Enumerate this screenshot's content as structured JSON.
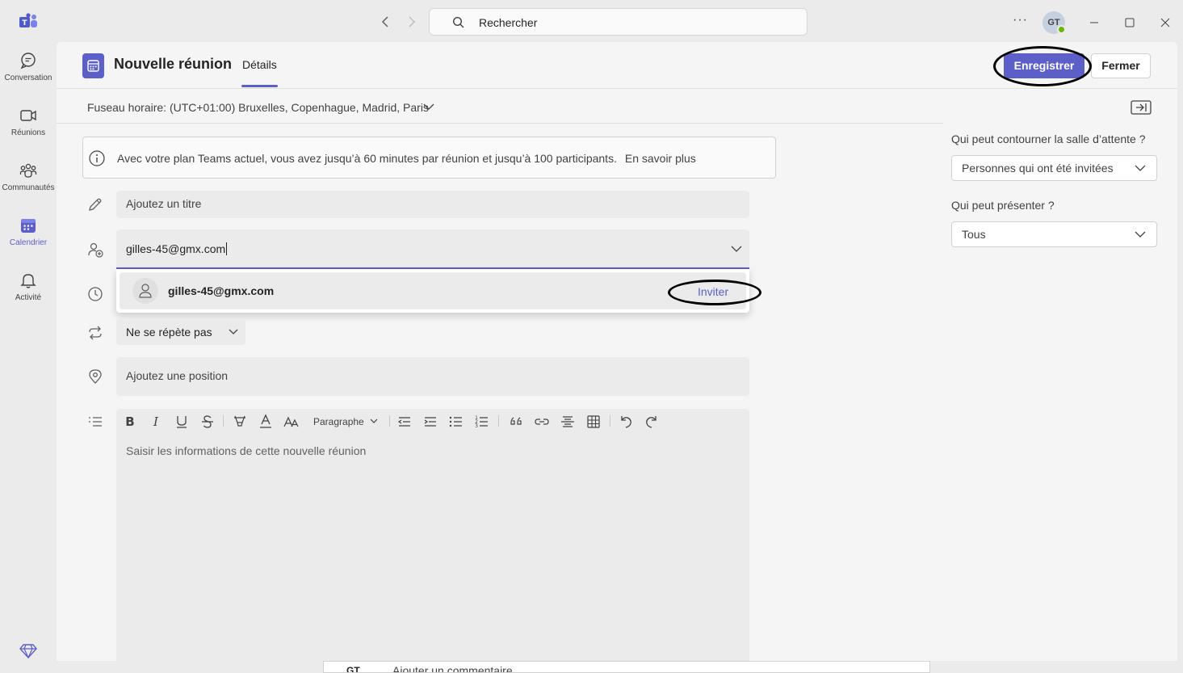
{
  "titlebar": {
    "search_placeholder": "Rechercher",
    "more_label": "···",
    "avatar_initials": "GT"
  },
  "rail": {
    "items": [
      {
        "label": "Conversation",
        "icon": "chat-icon"
      },
      {
        "label": "Réunions",
        "icon": "video-icon"
      },
      {
        "label": "Communautés",
        "icon": "community-icon"
      },
      {
        "label": "Calendrier",
        "icon": "calendar-icon",
        "active": true
      },
      {
        "label": "Activité",
        "icon": "bell-icon"
      }
    ]
  },
  "header": {
    "title": "Nouvelle réunion",
    "tab": "Détails",
    "save_label": "Enregistrer",
    "close_label": "Fermer"
  },
  "timezone": {
    "label": "Fuseau horaire: (UTC+01:00) Bruxelles, Copenhague, Madrid, Paris"
  },
  "info": {
    "message": "Avec votre plan Teams actuel, vous avez jusqu’à 60 minutes par réunion et jusqu’à 100 participants.",
    "link": "En savoir plus"
  },
  "form": {
    "title_placeholder": "Ajoutez un titre",
    "attendee_value": "gilles-45@gmx.com",
    "suggestion_name": "gilles-45@gmx.com",
    "suggestion_action": "Inviter",
    "repeat_value": "Ne se répète pas",
    "location_placeholder": "Ajoutez une position",
    "editor_placeholder": "Saisir les informations de cette nouvelle réunion",
    "paragraph_label": "Paragraphe"
  },
  "options": {
    "lobby_label": "Qui peut contourner la salle d’attente ?",
    "lobby_value": "Personnes qui ont été invitées",
    "presenter_label": "Qui peut présenter ?",
    "presenter_value": "Tous"
  },
  "behind": {
    "avatar_text": "GT",
    "comment_placeholder": "Ajouter un commentaire"
  },
  "colors": {
    "accent": "#5b5fc7",
    "presence": "#6bb700"
  }
}
